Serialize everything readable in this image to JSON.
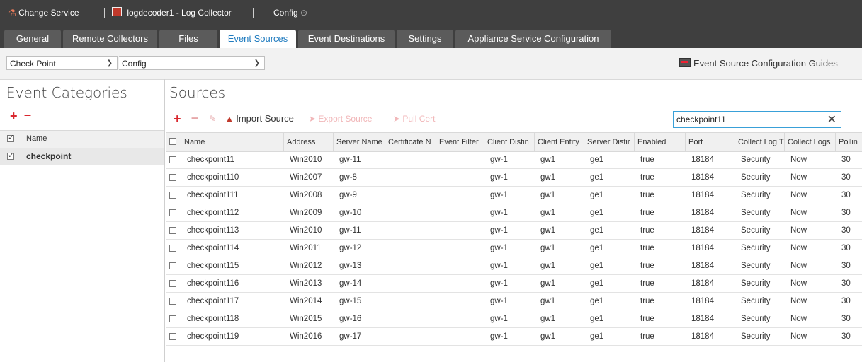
{
  "topbar": {
    "change_service": "Change Service",
    "service_name": "logdecoder1 - Log Collector",
    "config": "Config"
  },
  "tabs": [
    {
      "label": "General"
    },
    {
      "label": "Remote Collectors"
    },
    {
      "label": "Files"
    },
    {
      "label": "Event Sources"
    },
    {
      "label": "Event Destinations"
    },
    {
      "label": "Settings"
    },
    {
      "label": "Appliance Service Configuration"
    }
  ],
  "filter": {
    "event_source_type": "Check Point",
    "mode": "Config",
    "guides_label": "Event Source Configuration Guides"
  },
  "categories": {
    "title": "Event Categories",
    "header": "Name",
    "items": [
      {
        "label": "checkpoint"
      }
    ]
  },
  "sources": {
    "title": "Sources",
    "import_label": "Import Source",
    "export_label": "Export Source",
    "pull_cert_label": "Pull Cert",
    "search_value": "checkpoint11",
    "columns": [
      "Name",
      "Address",
      "Server Name",
      "Certificate N",
      "Event Filter",
      "Client Distin",
      "Client Entity",
      "Server Distir",
      "Enabled",
      "Port",
      "Collect Log T",
      "Collect Logs",
      "Pollin"
    ],
    "rows": [
      {
        "name": "checkpoint11",
        "address": "Win2010",
        "server": "gw-11",
        "client_dist": "gw-1",
        "client_entity": "gw1",
        "server_dist": "ge1",
        "enabled": "true",
        "port": "18184",
        "log_type": "Security",
        "collect": "Now",
        "polling": "30"
      },
      {
        "name": "checkpoint110",
        "address": "Win2007",
        "server": "gw-8",
        "client_dist": "gw-1",
        "client_entity": "gw1",
        "server_dist": "ge1",
        "enabled": "true",
        "port": "18184",
        "log_type": "Security",
        "collect": "Now",
        "polling": "30"
      },
      {
        "name": "checkpoint111",
        "address": "Win2008",
        "server": "gw-9",
        "client_dist": "gw-1",
        "client_entity": "gw1",
        "server_dist": "ge1",
        "enabled": "true",
        "port": "18184",
        "log_type": "Security",
        "collect": "Now",
        "polling": "30"
      },
      {
        "name": "checkpoint112",
        "address": "Win2009",
        "server": "gw-10",
        "client_dist": "gw-1",
        "client_entity": "gw1",
        "server_dist": "ge1",
        "enabled": "true",
        "port": "18184",
        "log_type": "Security",
        "collect": "Now",
        "polling": "30"
      },
      {
        "name": "checkpoint113",
        "address": "Win2010",
        "server": "gw-11",
        "client_dist": "gw-1",
        "client_entity": "gw1",
        "server_dist": "ge1",
        "enabled": "true",
        "port": "18184",
        "log_type": "Security",
        "collect": "Now",
        "polling": "30"
      },
      {
        "name": "checkpoint114",
        "address": "Win2011",
        "server": "gw-12",
        "client_dist": "gw-1",
        "client_entity": "gw1",
        "server_dist": "ge1",
        "enabled": "true",
        "port": "18184",
        "log_type": "Security",
        "collect": "Now",
        "polling": "30"
      },
      {
        "name": "checkpoint115",
        "address": "Win2012",
        "server": "gw-13",
        "client_dist": "gw-1",
        "client_entity": "gw1",
        "server_dist": "ge1",
        "enabled": "true",
        "port": "18184",
        "log_type": "Security",
        "collect": "Now",
        "polling": "30"
      },
      {
        "name": "checkpoint116",
        "address": "Win2013",
        "server": "gw-14",
        "client_dist": "gw-1",
        "client_entity": "gw1",
        "server_dist": "ge1",
        "enabled": "true",
        "port": "18184",
        "log_type": "Security",
        "collect": "Now",
        "polling": "30"
      },
      {
        "name": "checkpoint117",
        "address": "Win2014",
        "server": "gw-15",
        "client_dist": "gw-1",
        "client_entity": "gw1",
        "server_dist": "ge1",
        "enabled": "true",
        "port": "18184",
        "log_type": "Security",
        "collect": "Now",
        "polling": "30"
      },
      {
        "name": "checkpoint118",
        "address": "Win2015",
        "server": "gw-16",
        "client_dist": "gw-1",
        "client_entity": "gw1",
        "server_dist": "ge1",
        "enabled": "true",
        "port": "18184",
        "log_type": "Security",
        "collect": "Now",
        "polling": "30"
      },
      {
        "name": "checkpoint119",
        "address": "Win2016",
        "server": "gw-17",
        "client_dist": "gw-1",
        "client_entity": "gw1",
        "server_dist": "ge1",
        "enabled": "true",
        "port": "18184",
        "log_type": "Security",
        "collect": "Now",
        "polling": "30"
      }
    ]
  },
  "colors": {
    "accent": "#1f7bbf",
    "red": "#d9272e",
    "topbar": "#3f3f3f"
  }
}
